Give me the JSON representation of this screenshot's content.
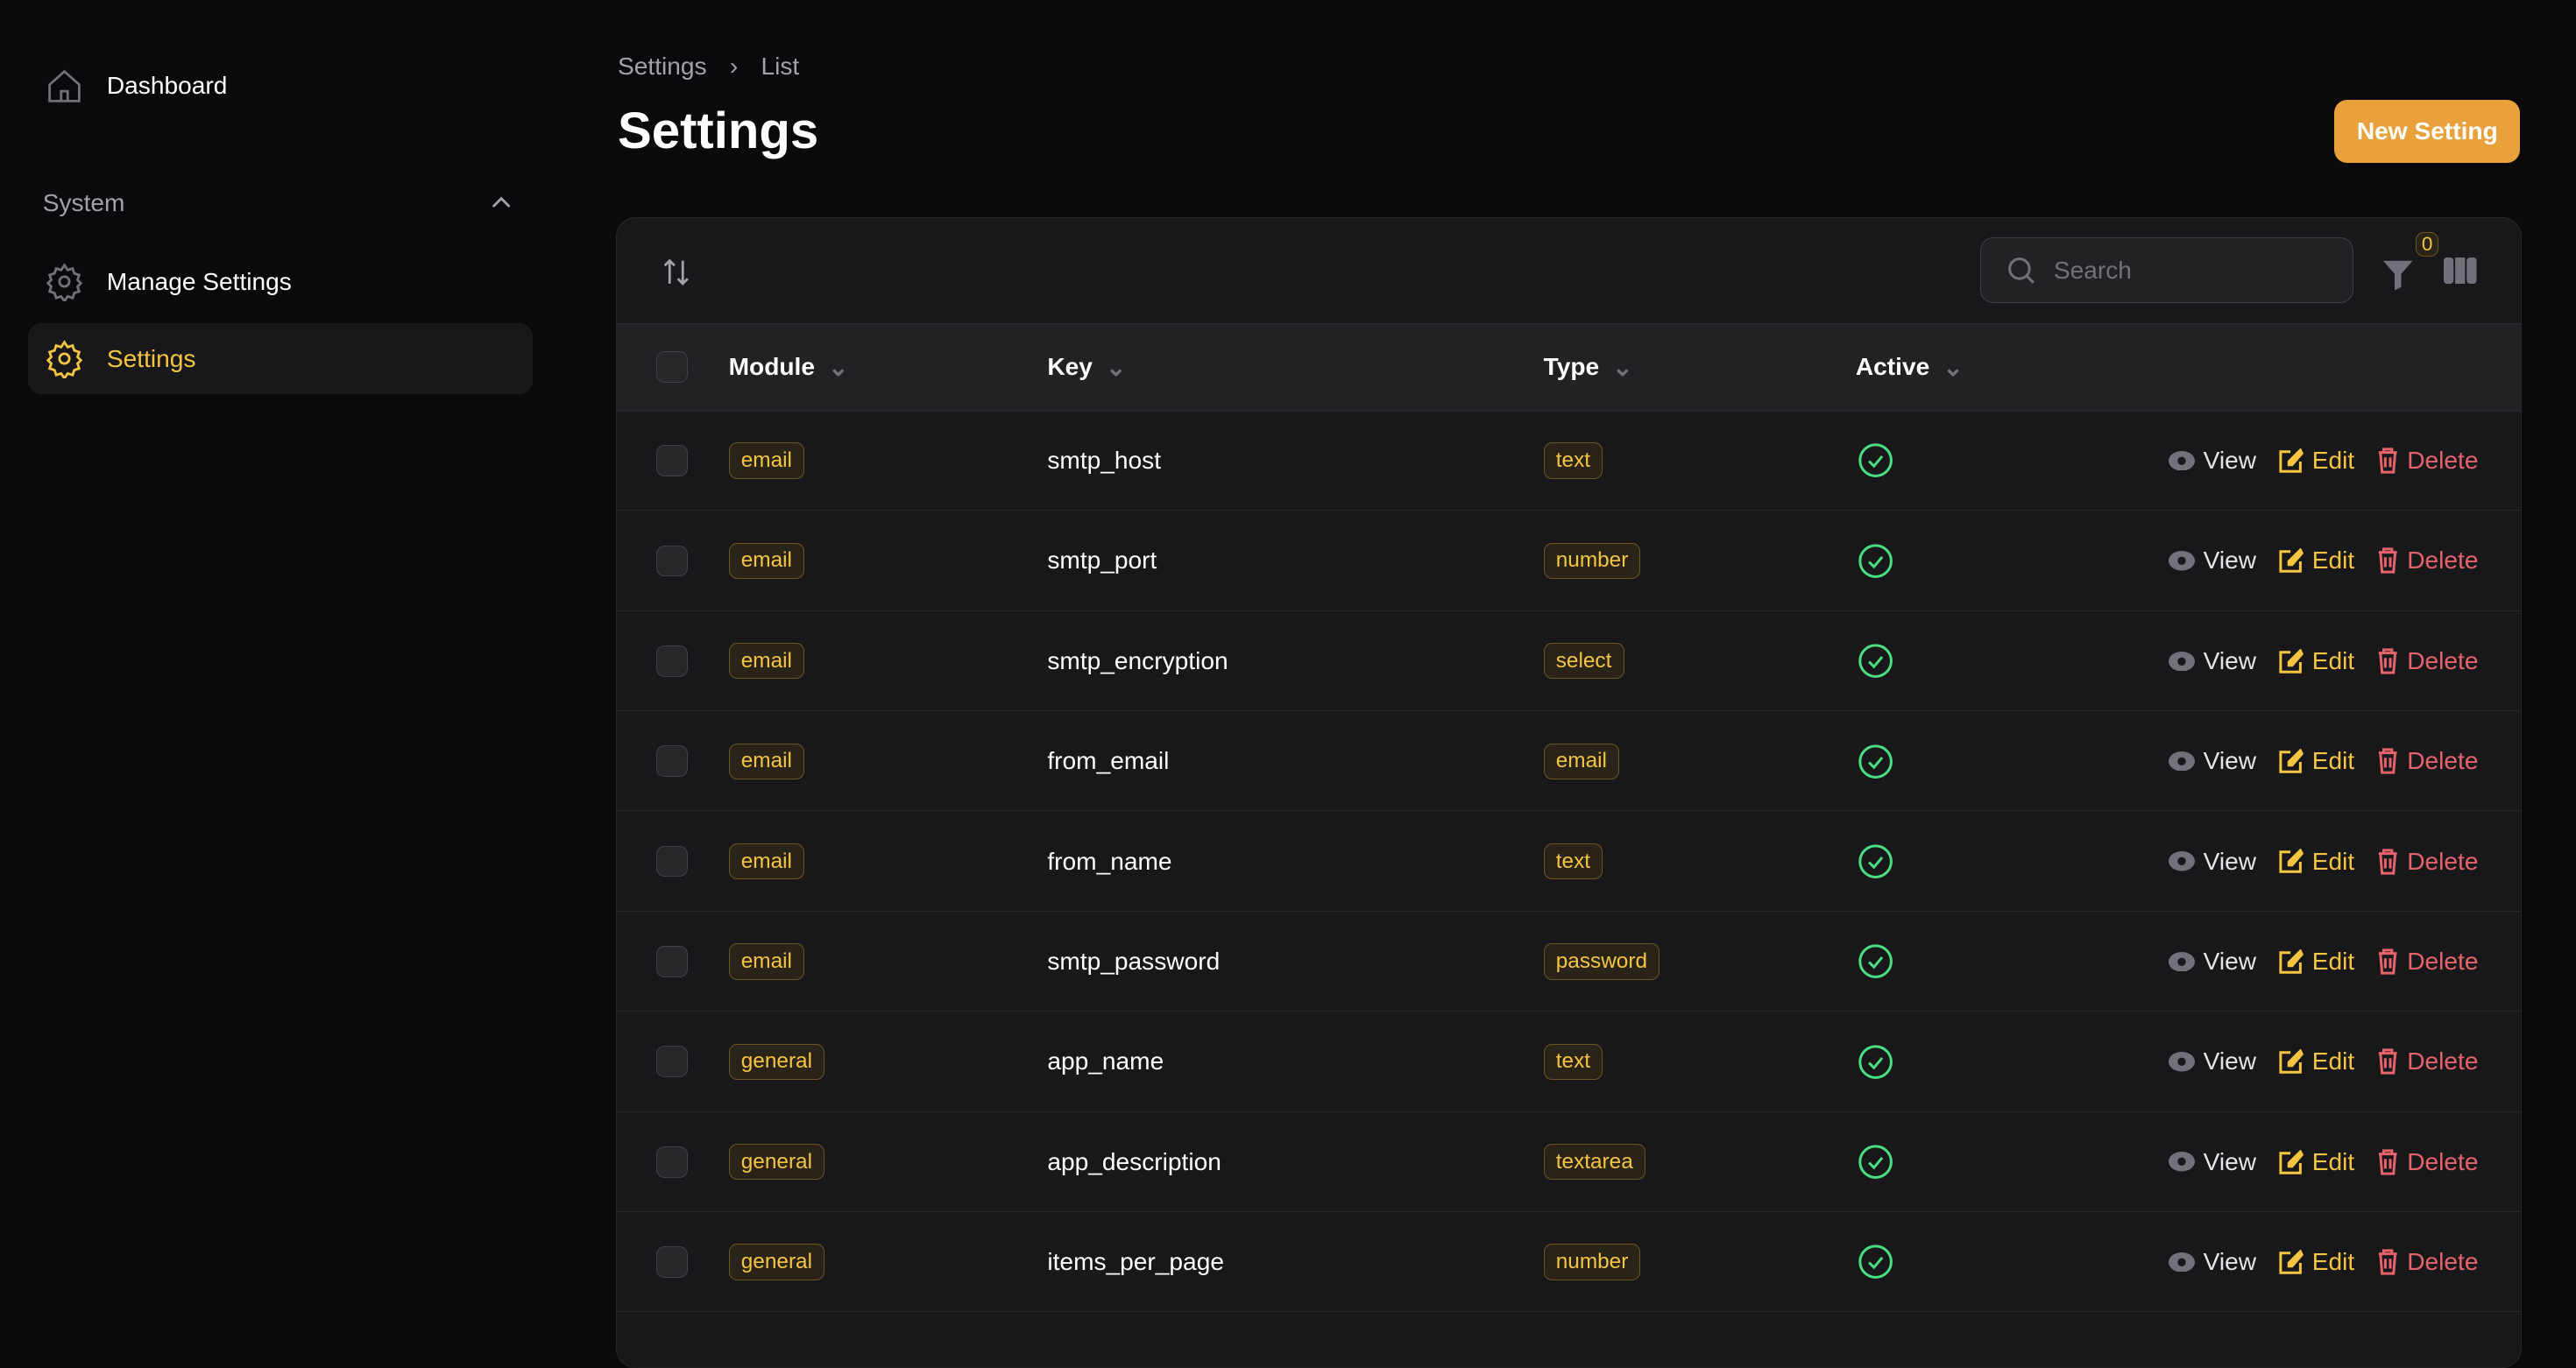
{
  "sidebar": {
    "dashboard": "Dashboard",
    "group": "System",
    "items": [
      {
        "label": "Manage Settings"
      },
      {
        "label": "Settings",
        "active": true
      }
    ]
  },
  "breadcrumb": {
    "root": "Settings",
    "current": "List"
  },
  "title": "Settings",
  "new_button": "New Setting",
  "toolbar": {
    "search_placeholder": "Search",
    "filter_count": "0"
  },
  "columns": {
    "module": "Module",
    "key": "Key",
    "type": "Type",
    "active": "Active"
  },
  "actions": {
    "view": "View",
    "edit": "Edit",
    "delete": "Delete"
  },
  "colors": {
    "accent": "#f5c542",
    "button": "#e9a23b",
    "delete": "#e5636b",
    "active": "#4ade80"
  },
  "rows": [
    {
      "module": "email",
      "key": "smtp_host",
      "type": "text",
      "active": true
    },
    {
      "module": "email",
      "key": "smtp_port",
      "type": "number",
      "active": true
    },
    {
      "module": "email",
      "key": "smtp_encryption",
      "type": "select",
      "active": true
    },
    {
      "module": "email",
      "key": "from_email",
      "type": "email",
      "active": true
    },
    {
      "module": "email",
      "key": "from_name",
      "type": "text",
      "active": true
    },
    {
      "module": "email",
      "key": "smtp_password",
      "type": "password",
      "active": true
    },
    {
      "module": "general",
      "key": "app_name",
      "type": "text",
      "active": true
    },
    {
      "module": "general",
      "key": "app_description",
      "type": "textarea",
      "active": true
    },
    {
      "module": "general",
      "key": "items_per_page",
      "type": "number",
      "active": true
    }
  ]
}
